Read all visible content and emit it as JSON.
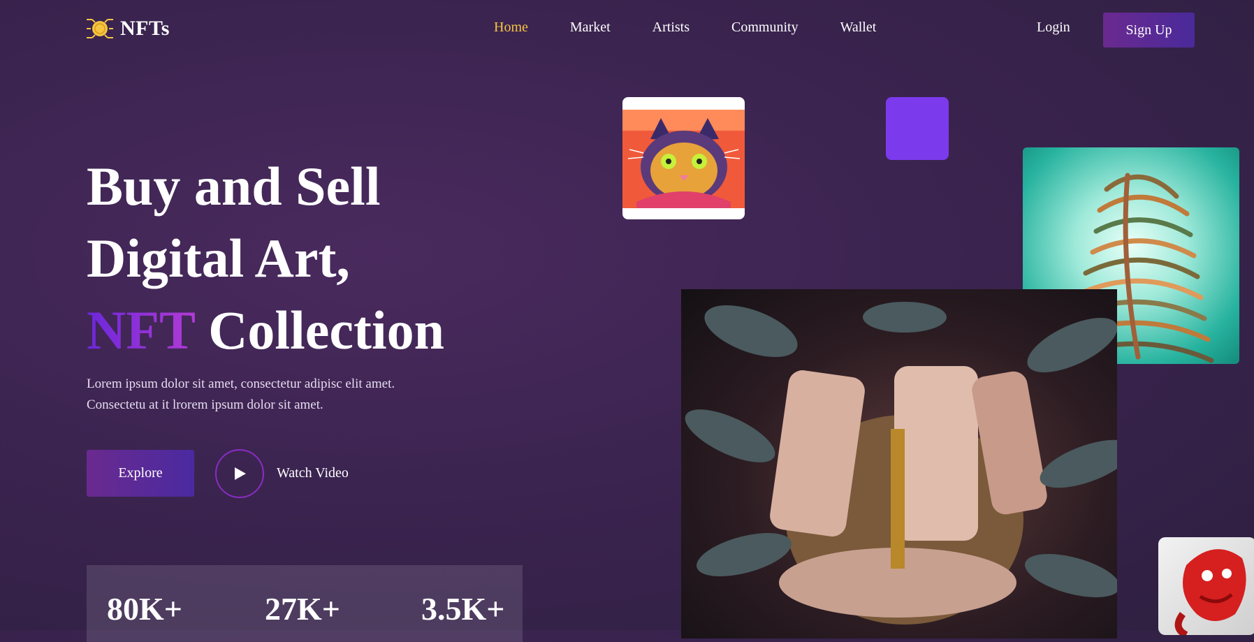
{
  "brand": {
    "name": "NFTs"
  },
  "nav": {
    "items": [
      {
        "label": "Home",
        "active": true
      },
      {
        "label": "Market",
        "active": false
      },
      {
        "label": "Artists",
        "active": false
      },
      {
        "label": "Community",
        "active": false
      },
      {
        "label": "Wallet",
        "active": false
      }
    ],
    "login": "Login",
    "signup": "Sign Up"
  },
  "hero": {
    "title_line1": "Buy and Sell",
    "title_line2": "Digital Art,",
    "title_accent": "NFT",
    "title_line3_rest": " Collection",
    "description_line1": "Lorem ipsum dolor sit amet, consectetur adipisc elit amet.",
    "description_line2": "Consectetu at it lrorem ipsum dolor sit amet.",
    "explore": "Explore",
    "watch_video": "Watch Video"
  },
  "stats": [
    {
      "value": "80K+"
    },
    {
      "value": "27K+"
    },
    {
      "value": "3.5K+"
    }
  ],
  "colors": {
    "accent_gold": "#f5c542",
    "accent_purple": "#7c3aed",
    "button_gradient_start": "#6a2a8f",
    "button_gradient_end": "#4a2aa0"
  },
  "icons": {
    "logo": "coin-chip-icon",
    "play": "play-icon"
  }
}
